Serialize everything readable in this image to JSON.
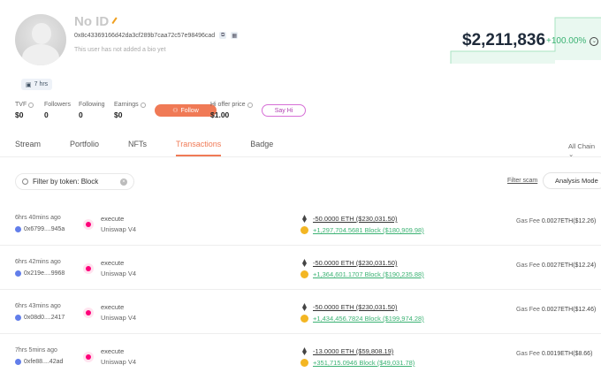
{
  "profile": {
    "name": "No ID",
    "address": "0x8c43369166d42da3cf289b7caa72c57e98496cad",
    "bio": "This user has not added a bio yet",
    "badge": "7 hrs"
  },
  "balance": {
    "value": "$2,211,836",
    "change": "+100.00%"
  },
  "stats": [
    {
      "label": "TVF",
      "value": "$0"
    },
    {
      "label": "Followers",
      "value": "0"
    },
    {
      "label": "Following",
      "value": "0"
    },
    {
      "label": "Earnings",
      "value": "$0"
    },
    {
      "label": "Hi offer price",
      "value": "$1.00"
    }
  ],
  "buttons": {
    "follow": "Follow",
    "say_hi": "Say Hi"
  },
  "tabs": [
    "Stream",
    "Portfolio",
    "NFTs",
    "Transactions",
    "Badge"
  ],
  "all_chain": "All Chain",
  "filter": {
    "text": "Filter by token: Block",
    "filter_scam": "Filter scam",
    "analysis": "Analysis Mode"
  },
  "transactions": [
    {
      "time": "6hrs 40mins ago",
      "hash": "0x6799....945a",
      "method": "execute",
      "protocol": "Uniswap V4",
      "out": "-50.0000 ETH ($230,031.50)",
      "in": "+1,297,704.5681 Block ($180,909.98)",
      "gas_label": "Gas Fee",
      "gas": "0.0027ETH($12.26)"
    },
    {
      "time": "6hrs 42mins ago",
      "hash": "0x219e....9968",
      "method": "execute",
      "protocol": "Uniswap V4",
      "out": "-50.0000 ETH ($230,031.50)",
      "in": "+1,364,601.1707 Block ($190,235.88)",
      "gas_label": "Gas Fee",
      "gas": "0.0027ETH($12.24)"
    },
    {
      "time": "6hrs 43mins ago",
      "hash": "0x08d0....2417",
      "method": "execute",
      "protocol": "Uniswap V4",
      "out": "-50.0000 ETH ($230,031.50)",
      "in": "+1,434,456.7824 Block ($199,974.28)",
      "gas_label": "Gas Fee",
      "gas": "0.0027ETH($12.46)"
    },
    {
      "time": "7hrs 5mins ago",
      "hash": "0xfe88....42ad",
      "method": "execute",
      "protocol": "Uniswap V4",
      "out": "-13.0000 ETH ($59,808.19)",
      "in": "+351,715.0946 Block ($49,031.78)",
      "gas_label": "Gas Fee",
      "gas": "0.0019ETH($8.66)"
    }
  ]
}
